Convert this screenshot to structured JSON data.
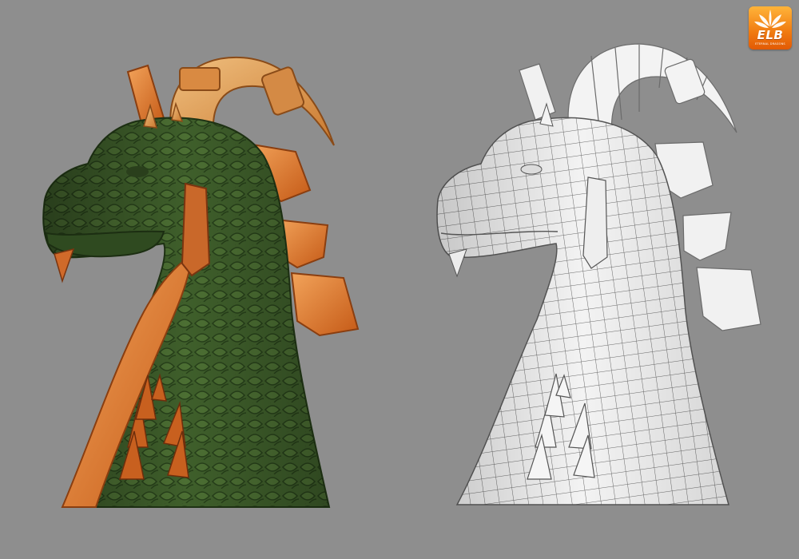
{
  "scene": {
    "background_color": "#8e8e8e",
    "panels": [
      {
        "name": "textured-render",
        "subject": "dragon head bust",
        "skin_color": "#3e5e2a",
        "accent_color": "#d9772e",
        "horn_color": "#e0a05a"
      },
      {
        "name": "wireframe-render",
        "subject": "dragon head bust",
        "surface_color": "#f4f4f4",
        "edge_color": "#6e6e6e"
      }
    ]
  },
  "logo": {
    "text": "ELB",
    "subtext": "ETERNAL DRAGONS",
    "icon": "leaf-icon",
    "colors": [
      "#ffb43a",
      "#e25a05"
    ]
  }
}
